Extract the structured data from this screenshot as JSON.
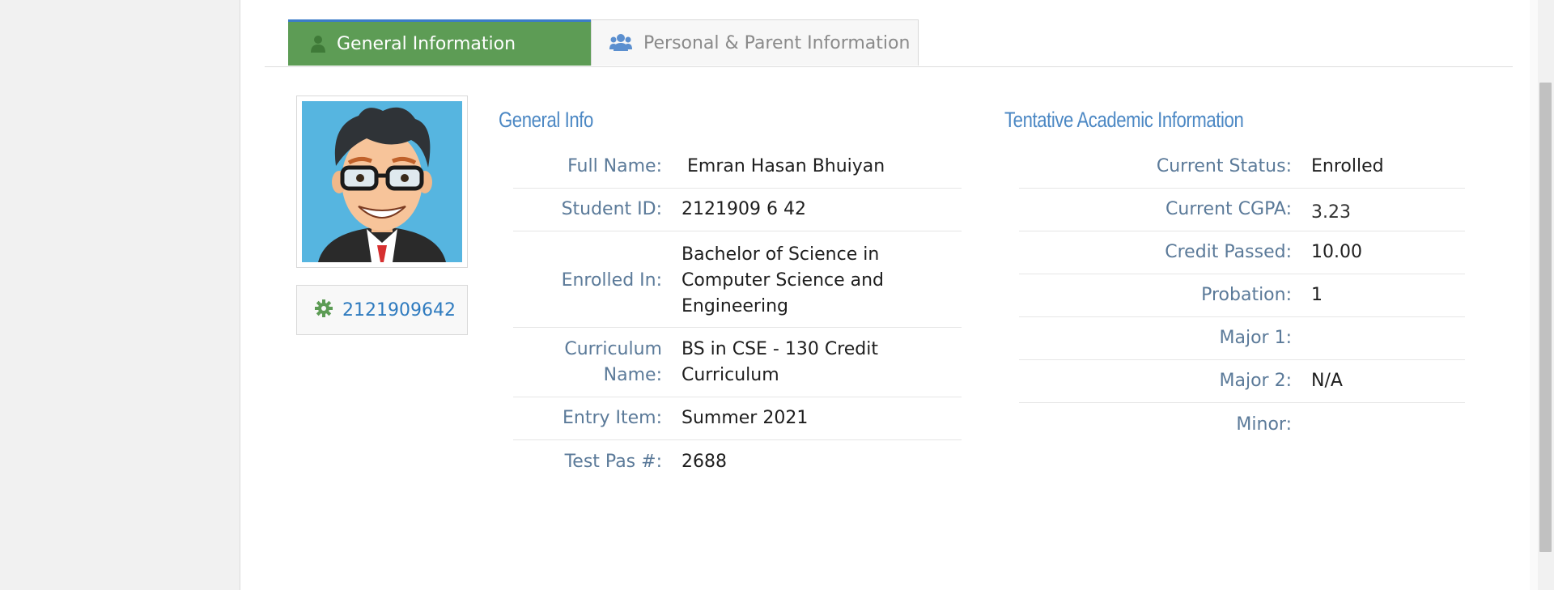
{
  "tabs": [
    {
      "label": "General Information",
      "icon": "user-icon"
    },
    {
      "label": "Personal & Parent Information",
      "icon": "users-icon"
    }
  ],
  "profile": {
    "avatar": "cartoon-avatar-with-glasses",
    "id_link": "2121909642"
  },
  "general_info": {
    "title": "General Info",
    "rows": [
      {
        "label": "Full Name:",
        "value": " Emran Hasan Bhuiyan"
      },
      {
        "label": "Student ID:",
        "value": "2121909 6 42"
      },
      {
        "label": "Enrolled In:",
        "value": "Bachelor of Science in Computer Science and Engineering"
      },
      {
        "label": "Curriculum Name:",
        "value": "BS in CSE - 130 Credit Curriculum"
      },
      {
        "label": "Entry Item:",
        "value": "Summer 2021"
      },
      {
        "label": "Test Pas #:",
        "value": "2688"
      }
    ]
  },
  "academic_info": {
    "title": "Tentative Academic Information",
    "rows": [
      {
        "label": "Current Status:",
        "value": "Enrolled"
      },
      {
        "label": "Current CGPA:",
        "value": "3.23"
      },
      {
        "label": "Credit Passed:",
        "value": "10.00"
      },
      {
        "label": "Probation:",
        "value": "1"
      },
      {
        "label": "Major 1:",
        "value": ""
      },
      {
        "label": "Major 2:",
        "value": "N/A"
      },
      {
        "label": "Minor:",
        "value": ""
      }
    ]
  },
  "colors": {
    "active_tab_bg": "#5d9c55",
    "accent_blue": "#4c88c4",
    "label_color": "#5b7a99",
    "gear_green": "#5d9c55"
  }
}
